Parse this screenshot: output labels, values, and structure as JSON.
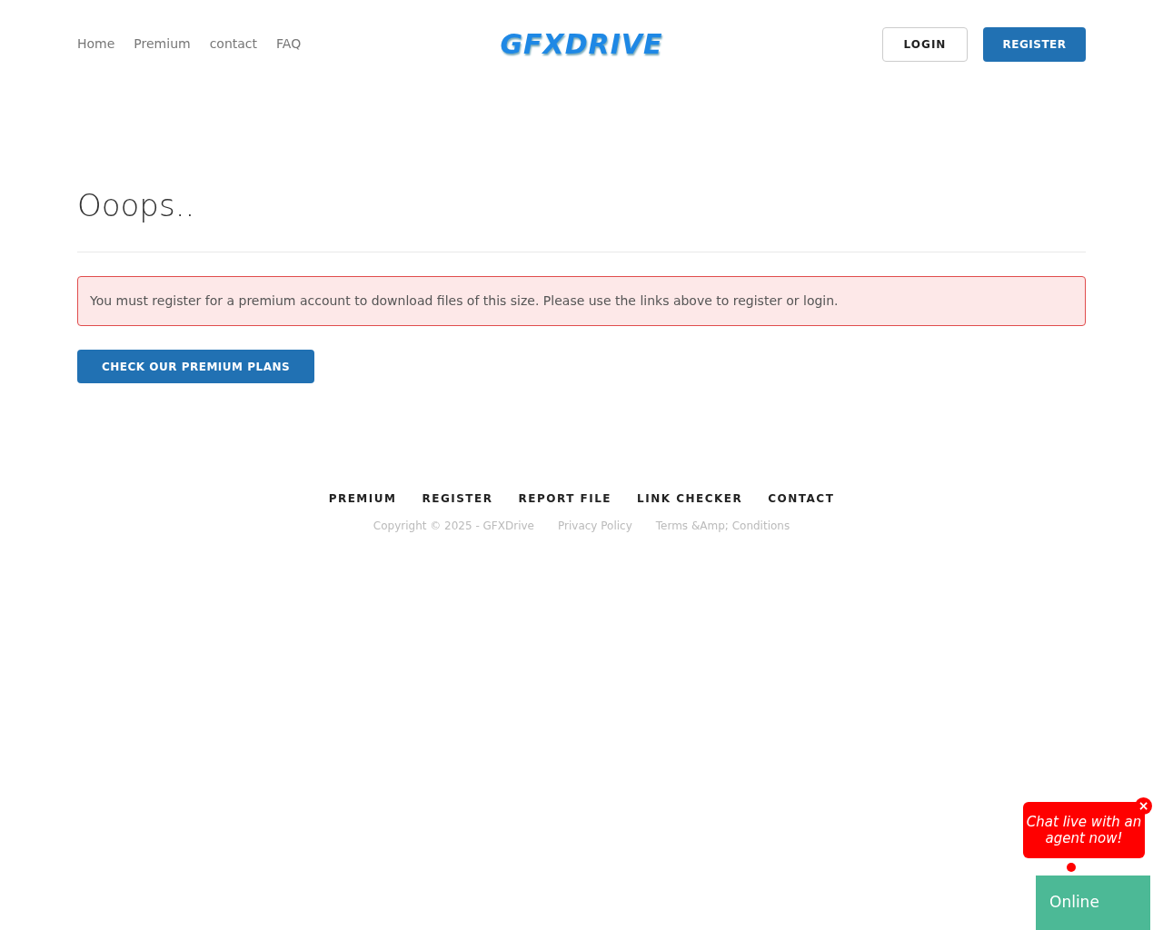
{
  "nav": {
    "links": [
      "Home",
      "Premium",
      "contact",
      "FAQ"
    ],
    "logo": "GFXDRIVE",
    "login": "LOGIN",
    "register": "REGISTER"
  },
  "main": {
    "title": "Ooops..",
    "alert": "You must register for a premium account to download files of this size. Please use the links above to register or login.",
    "button": "CHECK OUR PREMIUM PLANS"
  },
  "footer": {
    "links": [
      "PREMIUM",
      "REGISTER",
      "REPORT FILE",
      "LINK CHECKER",
      "CONTACT"
    ],
    "copyright": "Copyright © 2025 - GFXDrive",
    "legal": [
      "Privacy Policy",
      "Terms &Amp; Conditions"
    ]
  },
  "chat": {
    "bubble": "Chat live with an agent now!",
    "close": "×",
    "status": "Online"
  }
}
